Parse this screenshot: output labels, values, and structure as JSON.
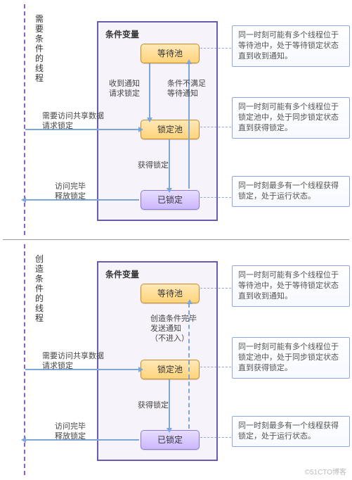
{
  "top": {
    "side_label": "需要条件的线程",
    "cond_title": "条件变量",
    "node_wait": "等待池",
    "node_lockpool": "锁定池",
    "node_locked": "已锁定",
    "lbl_recv": "收到通知\n请求锁定",
    "lbl_notmet": "条件不满足\n等待通知",
    "lbl_need": "需要访问共享数据\n请求锁定",
    "lbl_gotlock": "获得锁定",
    "lbl_done": "访问完毕\n释放锁定",
    "note_wait": "同一时刻可能有多个线程位于等待池中，处于等待锁定状态直到收到通知。",
    "note_lockpool": "同一时刻可能有多个线程位于锁定池中，处于同步锁定状态直到获得锁定。",
    "note_locked": "同一时刻最多有一个线程获得锁定，处于运行状态。"
  },
  "bottom": {
    "side_label": "创造条件的线程",
    "cond_title": "条件变量",
    "node_wait": "等待池",
    "node_lockpool": "锁定池",
    "node_locked": "已锁定",
    "lbl_notify": "创造条件完毕\n发送通知\n（不进入）",
    "lbl_need": "需要访问共享数据\n请求锁定",
    "lbl_gotlock": "获得锁定",
    "lbl_done": "访问完毕\n释放锁定",
    "note_wait": "同一时刻可能有多个线程位于等待池中，处于等待锁定状态直到收到通知。",
    "note_lockpool": "同一时刻可能有多个线程位于锁定池中，处于同步锁定状态直到获得锁定。",
    "note_locked": "同一时刻最多有一个线程获得锁定，处于运行状态。"
  },
  "watermark": "©51CTO博客"
}
